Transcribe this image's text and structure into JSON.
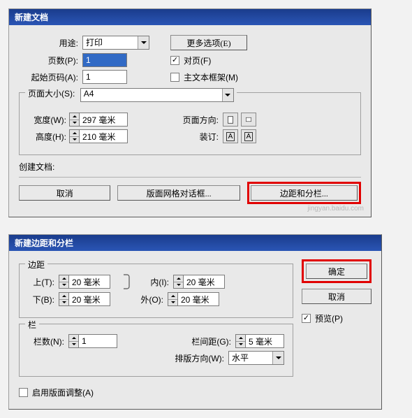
{
  "dialog1": {
    "title": "新建文档",
    "intent_label": "用途:",
    "intent_value": "打印",
    "more_options": "更多选项(E)",
    "pages_label": "页数(P):",
    "pages_value": "1",
    "facing_label": "对页(F)",
    "startpage_label": "起始页码(A):",
    "startpage_value": "1",
    "master_label": "主文本框架(M)",
    "pagesize_label": "页面大小(S):",
    "pagesize_value": "A4",
    "width_label": "宽度(W):",
    "width_value": "297 毫米",
    "height_label": "高度(H):",
    "height_value": "210 毫米",
    "orient_label": "页面方向:",
    "bind_label": "装订:",
    "create_label": "创建文档:",
    "cancel": "取消",
    "layout_grid": "版面网格对话框...",
    "margins_cols": "边距和分栏..."
  },
  "dialog2": {
    "title": "新建边距和分栏",
    "margins_legend": "边距",
    "top_label": "上(T):",
    "top_value": "20 毫米",
    "bottom_label": "下(B):",
    "bottom_value": "20 毫米",
    "inside_label": "内(I):",
    "inside_value": "20 毫米",
    "outside_label": "外(O):",
    "outside_value": "20 毫米",
    "cols_legend": "栏",
    "colnum_label": "栏数(N):",
    "colnum_value": "1",
    "gutter_label": "栏间距(G):",
    "gutter_value": "5 毫米",
    "writing_label": "排版方向(W):",
    "writing_value": "水平",
    "layoutadj_label": "启用版面调整(A)",
    "ok": "确定",
    "cancel": "取消",
    "preview_label": "预览(P)"
  }
}
